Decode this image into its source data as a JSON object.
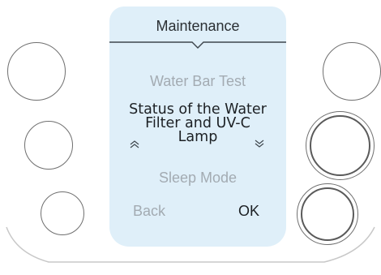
{
  "screen": {
    "title": "Maintenance",
    "menu": {
      "previous_item": "Water Bar Test",
      "selected_item": "Status of the Water\nFilter and UV-C\nLamp",
      "next_item": "Sleep Mode"
    },
    "softkeys": {
      "back_label": "Back",
      "ok_label": "OK"
    }
  },
  "colors": {
    "screen_background": "#dfeff9",
    "inactive_text": "#a3abb2",
    "active_text": "#1c2024"
  }
}
